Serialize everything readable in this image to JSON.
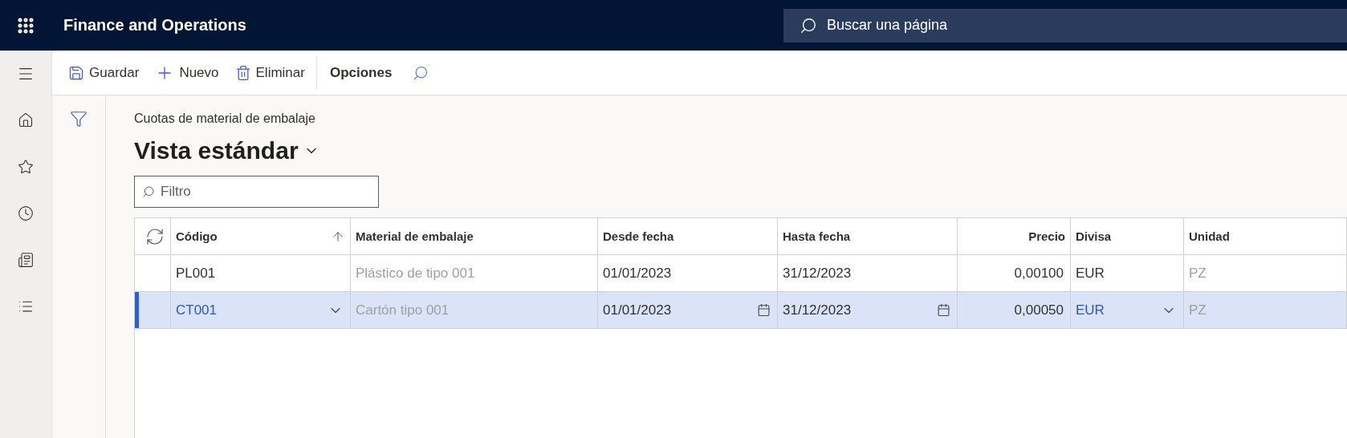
{
  "app_title": "Finance and Operations",
  "search": {
    "placeholder": "Buscar una página"
  },
  "toolbar": {
    "buttons": [
      {
        "kind": "save",
        "label": "Guardar"
      },
      {
        "kind": "new",
        "label": "Nuevo"
      },
      {
        "kind": "delete",
        "label": "Eliminar"
      }
    ],
    "options_tab": "Opciones"
  },
  "page_caption": "Cuotas de material de embalaje",
  "view_title": "Vista estándar",
  "filter": {
    "placeholder": "Filtro"
  },
  "table": {
    "columns": [
      {
        "label": "Código",
        "kind": "lookup",
        "sorted": true
      },
      {
        "label": "Material de embalaje",
        "kind": "readonly",
        "sorted": false
      },
      {
        "label": "Desde fecha",
        "kind": "date",
        "sorted": false
      },
      {
        "label": "Hasta fecha",
        "kind": "date",
        "sorted": false
      },
      {
        "label": "Precio",
        "kind": "number",
        "sorted": false
      },
      {
        "label": "Divisa",
        "kind": "lookup",
        "sorted": false
      },
      {
        "label": "Unidad",
        "kind": "readonly",
        "sorted": false
      }
    ],
    "rows": [
      {
        "selected": false,
        "cells": [
          "PL001",
          "Plástico de tipo 001",
          "01/01/2023",
          "31/12/2023",
          "0,00100",
          "EUR",
          "PZ"
        ]
      },
      {
        "selected": true,
        "cells": [
          "CT001",
          "Cartón tipo 001",
          "01/01/2023",
          "31/12/2023",
          "0,00050",
          "EUR",
          "PZ"
        ]
      }
    ]
  }
}
